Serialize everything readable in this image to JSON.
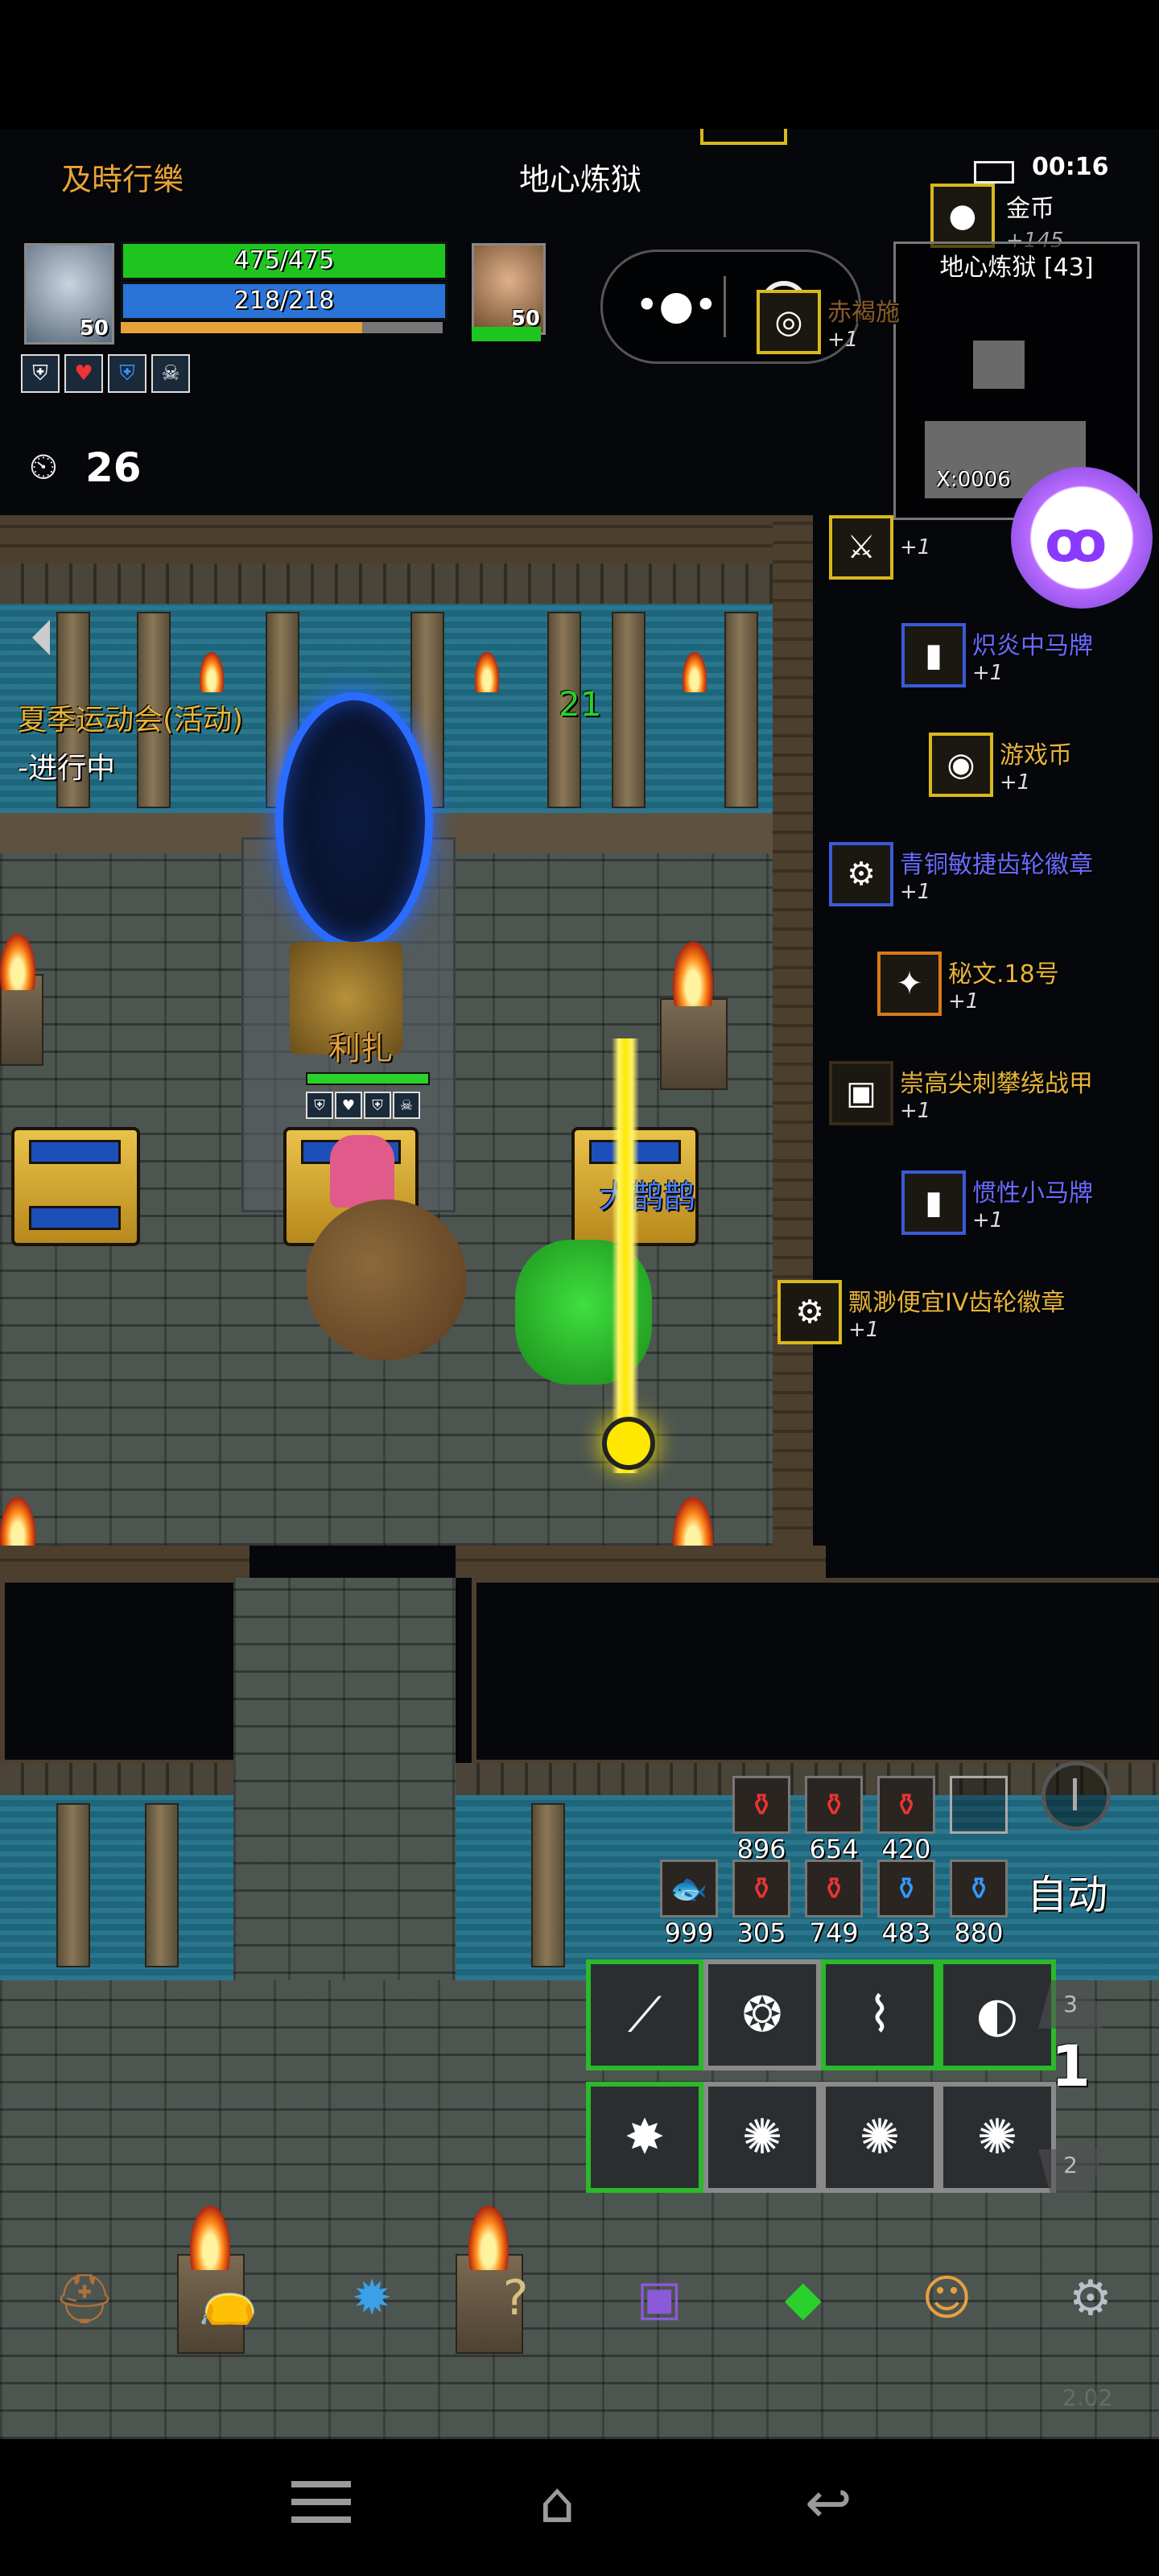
{
  "player": {
    "name": "及時行樂",
    "level": "50",
    "hp": "475/475",
    "mp": "218/218",
    "hp_fill": 1.0,
    "mp_fill": 1.0,
    "exp_fill": 0.75
  },
  "location": "地心炼狱",
  "companion": {
    "level": "50",
    "hp_fill": 1.0
  },
  "buff_icons": [
    "shield-icon",
    "heart-icon",
    "shield-icon",
    "skull-icon"
  ],
  "timer": {
    "value": "26"
  },
  "clock": "00:16",
  "minimap": {
    "title": "地心炼狱 [43]",
    "coords": "X:0006"
  },
  "gold_notice": {
    "label": "金币",
    "amount": "+145"
  },
  "event": {
    "title": "夏季运动会(活动)",
    "status": "-进行中"
  },
  "characters": {
    "enemy_name": "利扎",
    "ally_name": "大鹊鹊",
    "damage": "21"
  },
  "loot": [
    {
      "name": "赤褐施",
      "count": "+1",
      "color": "#8a5a2a",
      "icon": "ring-icon"
    },
    {
      "name": "",
      "count": "+1",
      "color": "#cfa04a",
      "icon": "sword-icon"
    },
    {
      "name": "炽炎中马牌",
      "count": "+1",
      "color": "#6a6aff",
      "icon": "card-icon"
    },
    {
      "name": "游戏币",
      "count": "+1",
      "color": "#e6b43a",
      "icon": "coin-icon"
    },
    {
      "name": "青铜敏捷齿轮徽章",
      "count": "+1",
      "color": "#6a6aff",
      "icon": "gear-badge-icon"
    },
    {
      "name": "秘文.18号",
      "count": "+1",
      "color": "#e6b43a",
      "icon": "rune-icon"
    },
    {
      "name": "崇高尖刺攀绕战甲",
      "count": "+1",
      "color": "#e6b43a",
      "icon": "armor-icon"
    },
    {
      "name": "惯性小马牌",
      "count": "+1",
      "color": "#6a6aff",
      "icon": "card-icon"
    },
    {
      "name": "飘渺便宜IV齿轮徽章",
      "count": "+1",
      "color": "#e6b43a",
      "icon": "gear-badge-icon"
    }
  ],
  "potions_row1": [
    "896",
    "654",
    "420",
    ""
  ],
  "potions_row2": [
    "999",
    "305",
    "749",
    "483",
    "880"
  ],
  "auto_label": "自动",
  "page_selector": {
    "up": "3",
    "current": "1",
    "down": "2"
  },
  "version": "2.02",
  "menu_icons": [
    "helmet-icon",
    "bag-icon",
    "skill-tree-icon",
    "quest-icon",
    "spellbook-icon",
    "gem-icon",
    "character-icon",
    "settings-icon"
  ]
}
